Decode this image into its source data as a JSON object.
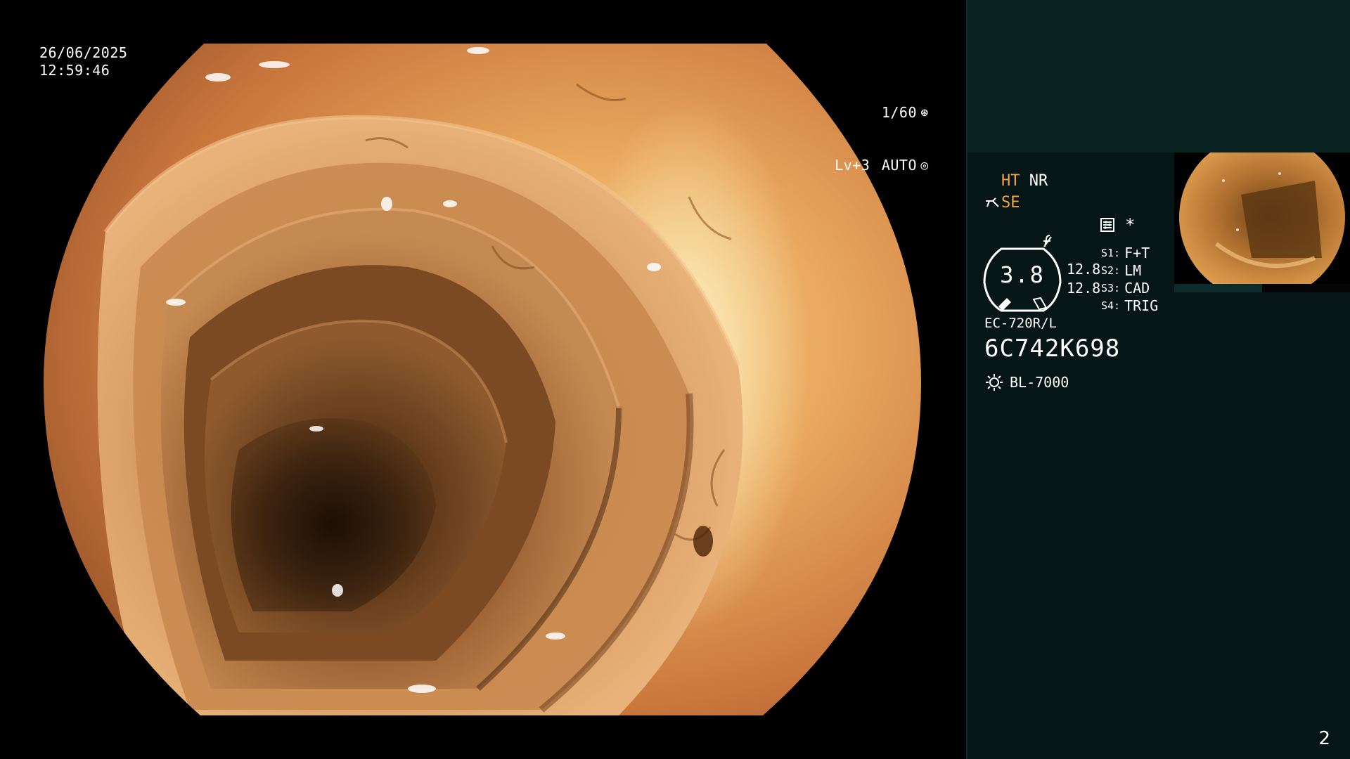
{
  "overlay": {
    "date": "26/06/2025",
    "time": "12:59:46",
    "shutter": "1/60",
    "shutter_icon": "aperture-icon",
    "level": "Lv+3",
    "mode": "AUTO",
    "mode_icon": "iris-icon"
  },
  "panel": {
    "ht": "HT",
    "nr": "NR",
    "se": "SE",
    "se_icon": "structure-enhance-icon",
    "f_icon": "color-mode-icon",
    "settings_icon": "settings-icon",
    "star": "*",
    "gauge_value": "3.8",
    "gauge_side": [
      "12.8",
      "12.8"
    ],
    "slots": [
      {
        "key": "S1:",
        "value": "F+T"
      },
      {
        "key": "S2:",
        "value": "LM"
      },
      {
        "key": "S3:",
        "value": "CAD"
      },
      {
        "key": "S4:",
        "value": "TRIG"
      }
    ],
    "model": "EC-720R/L",
    "serial": "6C742K698",
    "lamp_icon": "lamp-icon",
    "lamp": "BL-7000",
    "page_number": "2"
  },
  "colors": {
    "panel_bg": "#061515",
    "panel_top": "#0a2323",
    "accent_orange": "#f7a52e",
    "text": "#ffffff"
  }
}
